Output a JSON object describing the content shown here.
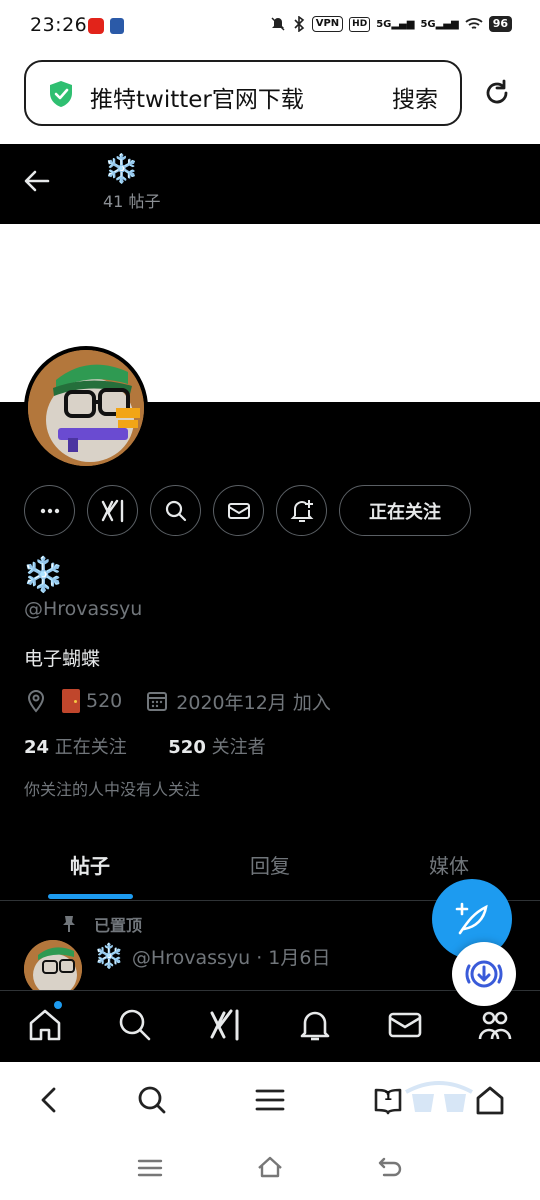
{
  "status_bar": {
    "time": "23:26",
    "network_5g_1": "5G",
    "network_5g_2": "5G",
    "vpn": "VPN",
    "hd": "HD",
    "battery": "96"
  },
  "browser": {
    "query": "推特twitter官网下载",
    "search_label": "搜索",
    "tab_count": "1"
  },
  "profile": {
    "nav_name": "❄️",
    "post_count": "41 帖子",
    "display_name": "❄️",
    "handle": "@Hrovassyu",
    "bio": "电子蝴蝶",
    "location": "520",
    "joined": "2020年12月 加入",
    "following_count": "24",
    "following_label": "正在关注",
    "followers_count": "520",
    "followers_label": "关注者",
    "mutual_note": "你关注的人中没有人关注",
    "follow_button": "正在关注"
  },
  "tabs": [
    {
      "label": "帖子",
      "active": true
    },
    {
      "label": "回复",
      "active": false
    },
    {
      "label": "媒体",
      "active": false
    }
  ],
  "tweet": {
    "pinned_label": "已置顶",
    "author_name": "❄️",
    "meta": "@Hrovassyu · 1月6日"
  },
  "colors": {
    "accent": "#1d9bf0",
    "name": "#8cc9f2",
    "muted": "#71767b",
    "text": "#e7e9ea",
    "background": "#000000"
  }
}
